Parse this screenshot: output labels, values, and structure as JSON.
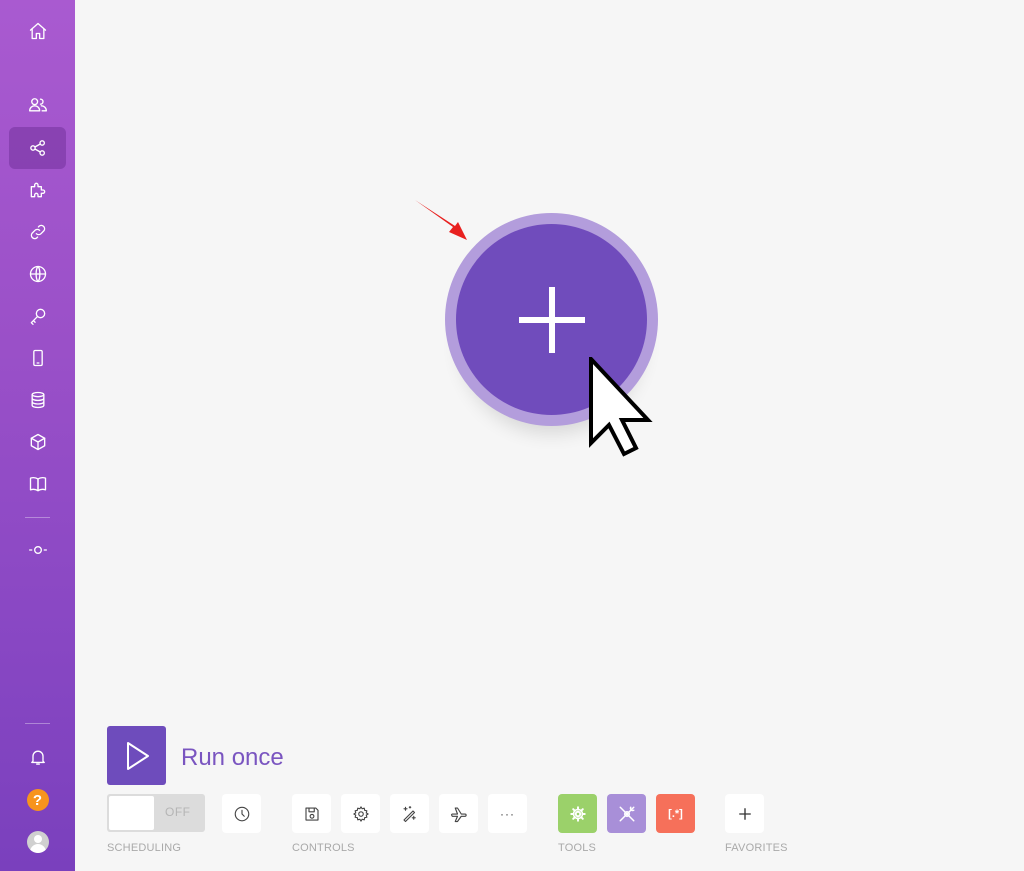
{
  "sidebar": {
    "items": [
      {
        "name": "home",
        "icon": "home-icon",
        "active": false
      },
      {
        "name": "teams",
        "icon": "users-icon",
        "active": false
      },
      {
        "name": "scenarios",
        "icon": "share-icon",
        "active": true
      },
      {
        "name": "templates",
        "icon": "puzzle-icon",
        "active": false
      },
      {
        "name": "connections",
        "icon": "link-icon",
        "active": false
      },
      {
        "name": "webhooks",
        "icon": "globe-icon",
        "active": false
      },
      {
        "name": "keys",
        "icon": "key-icon",
        "active": false
      },
      {
        "name": "devices",
        "icon": "mobile-icon",
        "active": false
      },
      {
        "name": "data-stores",
        "icon": "database-icon",
        "active": false
      },
      {
        "name": "data-structures",
        "icon": "cube-icon",
        "active": false
      },
      {
        "name": "docs",
        "icon": "book-icon",
        "active": false
      },
      {
        "name": "commits",
        "icon": "commit-icon",
        "active": false
      }
    ],
    "bottom": {
      "notifications_icon": "bell-icon",
      "help_label": "?",
      "avatar_icon": "user-avatar"
    }
  },
  "canvas": {
    "add_module_icon": "plus-icon",
    "annotation_icon": "red-arrow-icon",
    "pointer_icon": "mouse-cursor-icon"
  },
  "toolbar": {
    "run_once_label": "Run once",
    "scheduling": {
      "toggle_state": "OFF",
      "label": "SCHEDULING"
    },
    "controls_label": "CONTROLS",
    "tools_label": "TOOLS",
    "favorites_label": "FAVORITES",
    "more_label": "···",
    "tools": [
      {
        "name": "flow-control",
        "color": "#9bd16a"
      },
      {
        "name": "tools",
        "color": "#a88fd8"
      },
      {
        "name": "text-parser",
        "color": "#f6705a"
      }
    ],
    "text_parser_glyph": "[.*]"
  },
  "colors": {
    "accent": "#704cbc",
    "accent_light": "#b39ddc",
    "help": "#f7941d"
  }
}
